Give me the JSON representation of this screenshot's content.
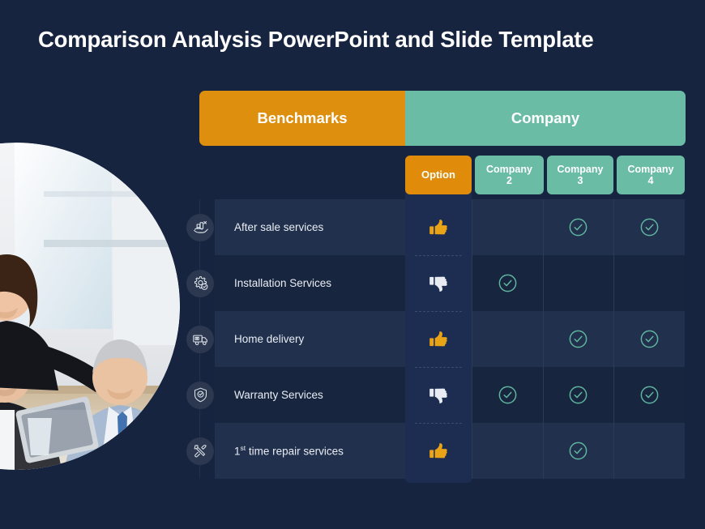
{
  "slide": {
    "title": "Comparison Analysis PowerPoint and Slide Template",
    "background_color": "#16243f"
  },
  "colors": {
    "benchmarks_orange": "#dd8f0d",
    "company_teal": "#6bbca5",
    "row_light": "#21304c",
    "row_dark": "#17253f",
    "option_panel": "#1c2d51",
    "thumb_up": "#e8a317",
    "thumb_down": "#e8ecf2",
    "check_teal": "#5fb79f"
  },
  "photo": {
    "name": "business-team-meeting-photo",
    "alt": "Group of business professionals gathered around a table looking at a tablet"
  },
  "group_headers": [
    {
      "label": "Benchmarks",
      "color": "#dd8f0d"
    },
    {
      "label": "Company",
      "color": "#6bbca5"
    }
  ],
  "column_headers": [
    {
      "label": "Option",
      "color": "#e08b09",
      "key": "option"
    },
    {
      "label": "Company\n2",
      "line1": "Company",
      "line2": "2",
      "color": "#6bbca5",
      "key": "company2"
    },
    {
      "label": "Company\n3",
      "line1": "Company",
      "line2": "3",
      "color": "#6bbca5",
      "key": "company3"
    },
    {
      "label": "Company\n4",
      "line1": "Company",
      "line2": "4",
      "color": "#6bbca5",
      "key": "company4"
    }
  ],
  "rows": [
    {
      "label": "After sale services",
      "label_html": "After sale services",
      "icon": "hand-holding-box-icon",
      "option": "thumbs-up",
      "company2": "",
      "company3": "check",
      "company4": "check"
    },
    {
      "label": "Installation Services",
      "label_html": "Installation Services",
      "icon": "gear-check-icon",
      "option": "thumbs-down",
      "company2": "check",
      "company3": "",
      "company4": ""
    },
    {
      "label": "Home delivery",
      "label_html": "Home delivery",
      "icon": "delivery-truck-icon",
      "option": "thumbs-up",
      "company2": "",
      "company3": "check",
      "company4": "check"
    },
    {
      "label": "Warranty Services",
      "label_html": "Warranty Services",
      "icon": "shield-check-icon",
      "option": "thumbs-down",
      "company2": "check",
      "company3": "check",
      "company4": "check"
    },
    {
      "label": "1st time repair services",
      "label_html": "1<sup>st</sup> time repair services",
      "icon": "tools-icon",
      "option": "thumbs-up",
      "company2": "",
      "company3": "check",
      "company4": ""
    }
  ]
}
